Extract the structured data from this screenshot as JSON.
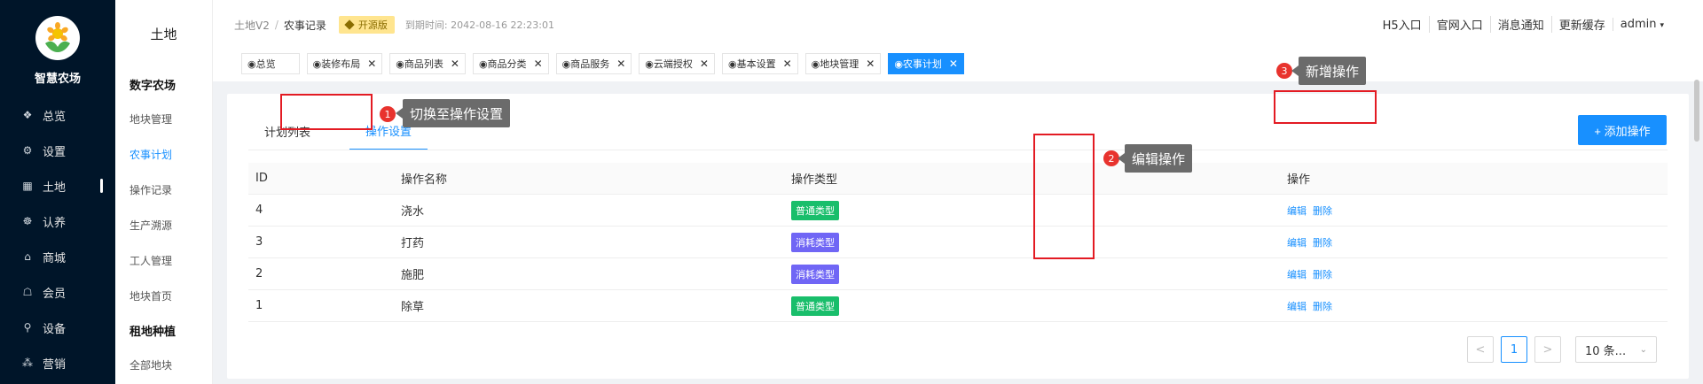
{
  "brand": {
    "name": "智慧农场",
    "logo_icon": "sunflower-logo-icon",
    "colors": {
      "sidebar": "#001529",
      "accent": "#1890ff",
      "highlight": "#e31b23"
    }
  },
  "sidebar": {
    "items": [
      {
        "label": "总览",
        "icon": "overview-icon",
        "glyph": "❖"
      },
      {
        "label": "设置",
        "icon": "gear-icon",
        "glyph": "⚙"
      },
      {
        "label": "土地",
        "icon": "land-grid-icon",
        "glyph": "▦"
      },
      {
        "label": "认养",
        "icon": "adopt-icon",
        "glyph": "☸"
      },
      {
        "label": "商城",
        "icon": "shop-icon",
        "glyph": "⌂"
      },
      {
        "label": "会员",
        "icon": "member-icon",
        "glyph": "☖"
      },
      {
        "label": "设备",
        "icon": "device-icon",
        "glyph": "⚲"
      },
      {
        "label": "营销",
        "icon": "marketing-icon",
        "glyph": "⁂"
      }
    ],
    "active_index": 2
  },
  "subnav": {
    "title": "土地",
    "group1": "数字农场",
    "group1_items": [
      "地块管理",
      "农事计划",
      "操作记录",
      "生产溯源",
      "工人管理",
      "地块首页"
    ],
    "group1_active": 1,
    "group2": "租地种植",
    "group2_items": [
      "全部地块"
    ]
  },
  "header": {
    "crumb_root": "土地V2",
    "crumb_sep": "/",
    "crumb_current": "农事记录",
    "badge": "开源版",
    "expire": "到期时间: 2042-08-16 22:23:01",
    "links": [
      "H5入口",
      "官网入口",
      "消息通知",
      "更新缓存"
    ],
    "user": "admin",
    "caret": "▾"
  },
  "tags": [
    {
      "label": "◉总览",
      "closable": false
    },
    {
      "label": "◉装修布局",
      "closable": true
    },
    {
      "label": "◉商品列表",
      "closable": true
    },
    {
      "label": "◉商品分类",
      "closable": true
    },
    {
      "label": "◉商品服务",
      "closable": true
    },
    {
      "label": "◉云端授权",
      "closable": true
    },
    {
      "label": "◉基本设置",
      "closable": true
    },
    {
      "label": "◉地块管理",
      "closable": true
    },
    {
      "label": "◉农事计划",
      "closable": true,
      "active": true
    }
  ],
  "tabs": [
    "计划列表",
    "操作设置"
  ],
  "add_button": "+ 添加操作",
  "annotations": [
    {
      "num": "1",
      "text": "切换至操作设置"
    },
    {
      "num": "2",
      "text": "编辑操作"
    },
    {
      "num": "3",
      "text": "新增操作"
    }
  ],
  "table": {
    "columns": [
      "ID",
      "操作名称",
      "操作类型",
      "操作"
    ],
    "rows": [
      {
        "id": "4",
        "name": "浇水",
        "type": "普通类型",
        "type_color": "#19be6b",
        "edit": "编辑",
        "delete": "删除"
      },
      {
        "id": "3",
        "name": "打药",
        "type": "消耗类型",
        "type_color": "#7066f5",
        "edit": "编辑",
        "delete": "删除"
      },
      {
        "id": "2",
        "name": "施肥",
        "type": "消耗类型",
        "type_color": "#7066f5",
        "edit": "编辑",
        "delete": "删除"
      },
      {
        "id": "1",
        "name": "除草",
        "type": "普通类型",
        "type_color": "#19be6b",
        "edit": "编辑",
        "delete": "删除"
      }
    ]
  },
  "pagination": {
    "prev": "<",
    "current": "1",
    "next": ">",
    "page_size": "10 条...",
    "chevron": "⌄"
  }
}
